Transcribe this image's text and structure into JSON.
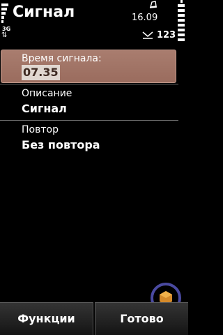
{
  "status": {
    "network": "3G",
    "net_arrows": "⇅",
    "date": "16.09",
    "mode": "123"
  },
  "app": {
    "title": "Сигнал"
  },
  "fields": {
    "alarm_time": {
      "label": "Время сигнала:",
      "value": "07.35"
    },
    "description": {
      "label": "Описание",
      "value": "Сигнал"
    },
    "repeat": {
      "label": "Повтор",
      "value": "Без повтора"
    }
  },
  "softkeys": {
    "left": "Функции",
    "right": "Готово"
  },
  "colors": {
    "highlight": "#a97d6f",
    "background": "#000000",
    "time_box": "#e0d7d0"
  }
}
